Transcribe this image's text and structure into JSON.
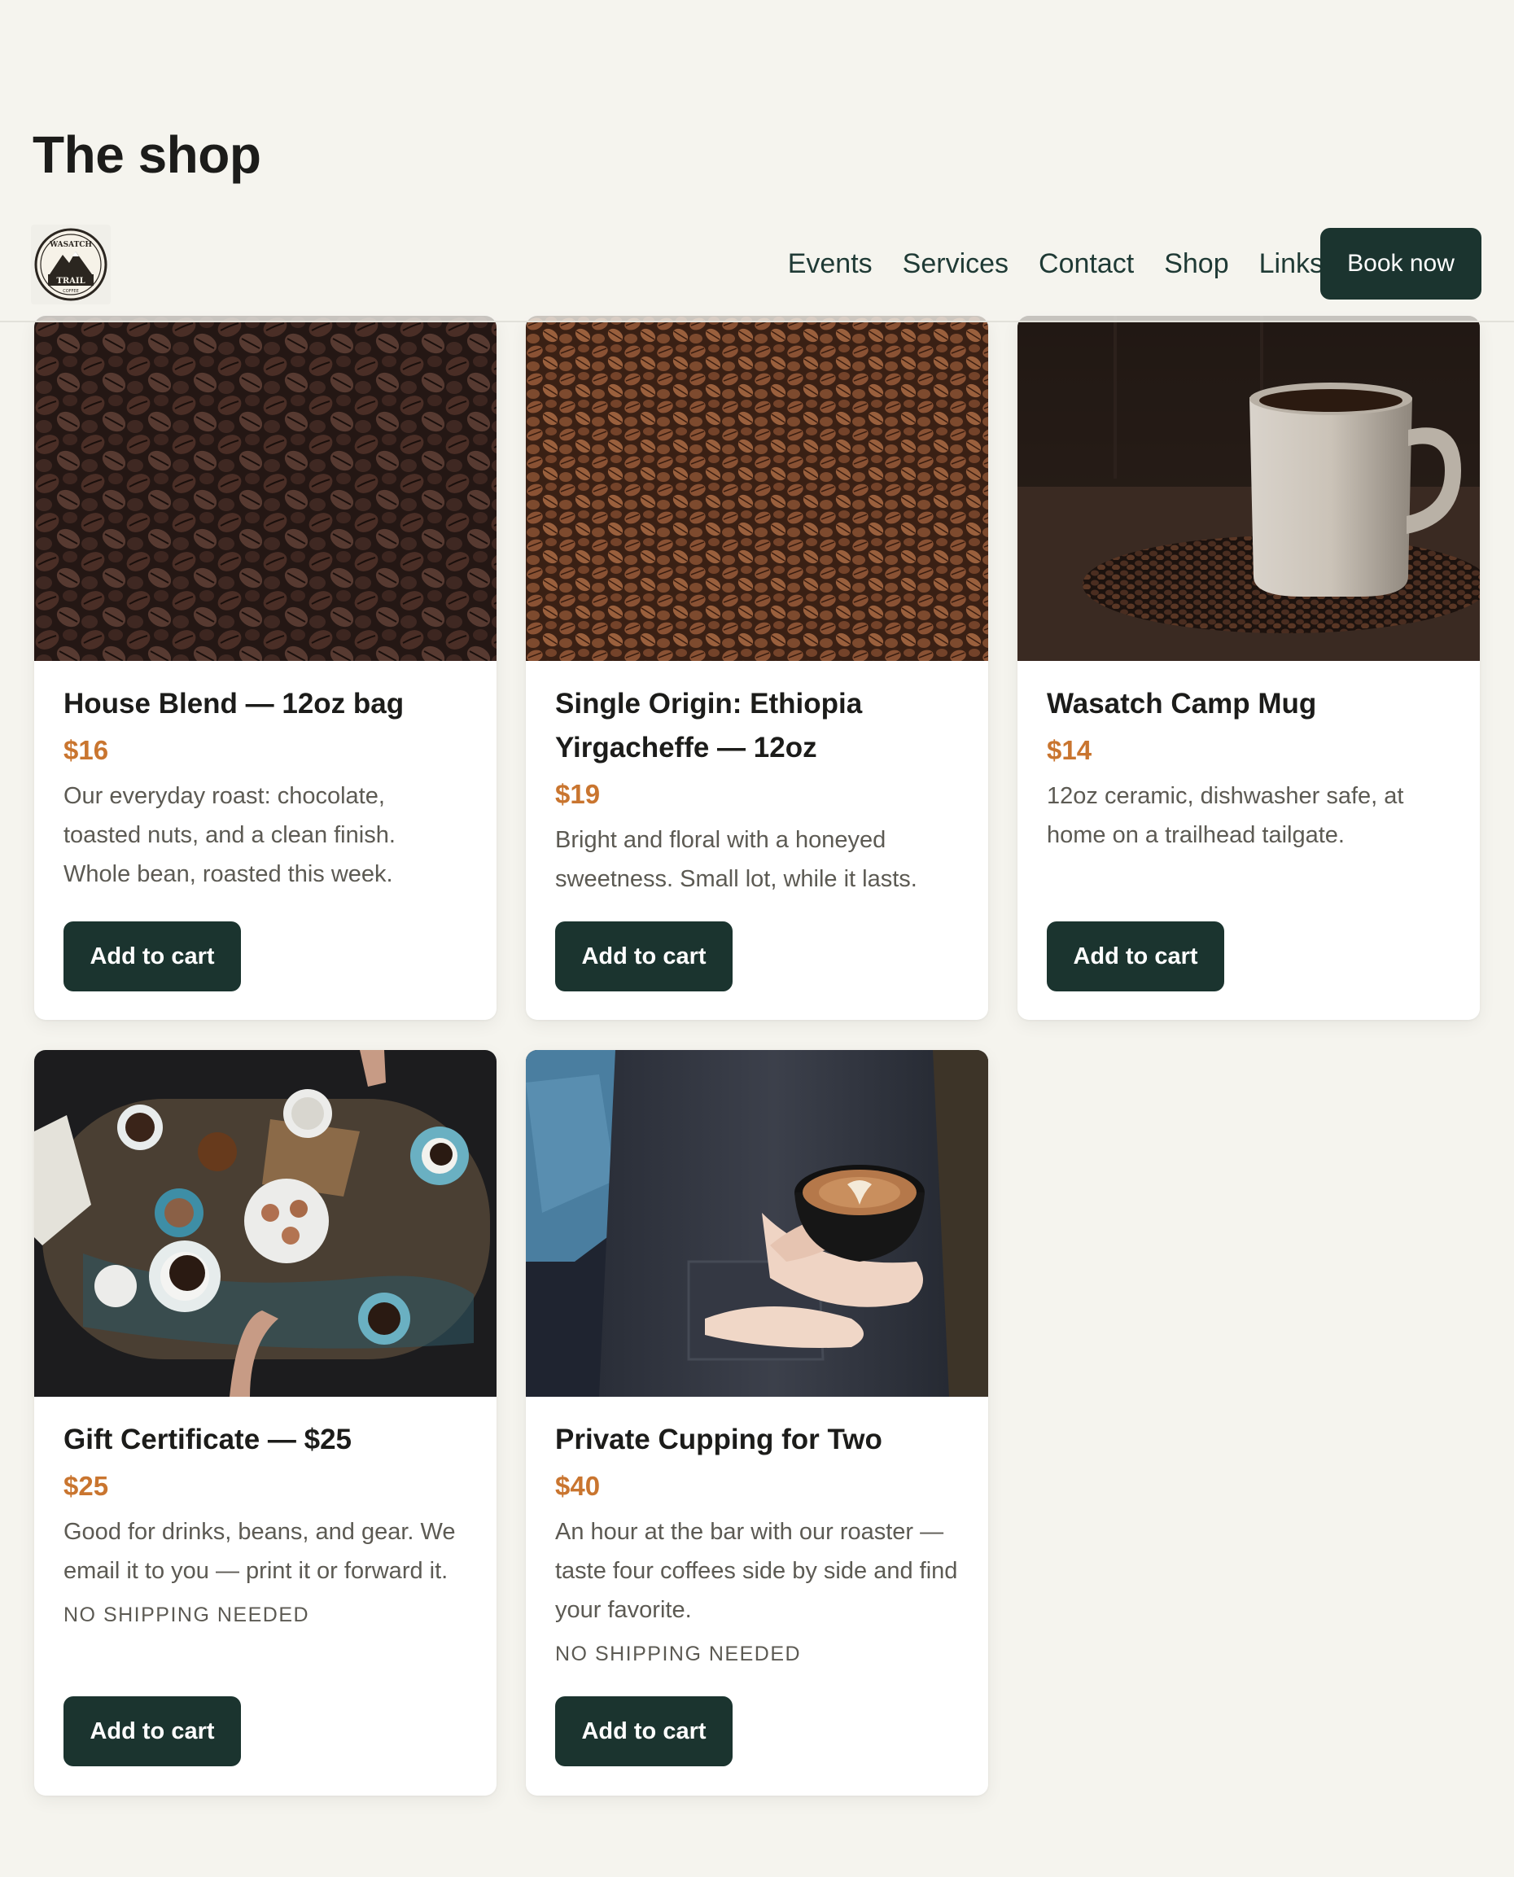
{
  "page": {
    "title": "The shop"
  },
  "nav": {
    "logo": {
      "line1": "WASATCH",
      "line2": "TRAIL",
      "line3": "COFFEE"
    },
    "links": [
      "Events",
      "Services",
      "Contact",
      "Shop",
      "Links"
    ],
    "cta": "Book now"
  },
  "products": [
    {
      "title": "House Blend — 12oz bag",
      "price": "$16",
      "description": "Our everyday roast: chocolate, toasted nuts, and a clean finish. Whole bean, roasted this week.",
      "note": "",
      "button": "Add to cart"
    },
    {
      "title": "Single Origin: Ethiopia Yirgacheffe — 12oz",
      "price": "$19",
      "description": "Bright and floral with a honeyed sweetness. Small lot, while it lasts.",
      "note": "",
      "button": "Add to cart"
    },
    {
      "title": "Wasatch Camp Mug",
      "price": "$14",
      "description": "12oz ceramic, dishwasher safe, at home on a trailhead tailgate.",
      "note": "",
      "button": "Add to cart"
    },
    {
      "title": "Gift Certificate — $25",
      "price": "$25",
      "description": "Good for drinks, beans, and gear. We email it to you — print it or forward it.",
      "note": "NO SHIPPING NEEDED",
      "button": "Add to cart"
    },
    {
      "title": "Private Cupping for Two",
      "price": "$40",
      "description": "An hour at the bar with our roaster — taste four coffees side by side and find your favorite.",
      "note": "NO SHIPPING NEEDED",
      "button": "Add to cart"
    }
  ],
  "colors": {
    "background": "#f5f4ee",
    "primary": "#1b342f",
    "price": "#c9752f",
    "muted": "#5c5a53"
  }
}
